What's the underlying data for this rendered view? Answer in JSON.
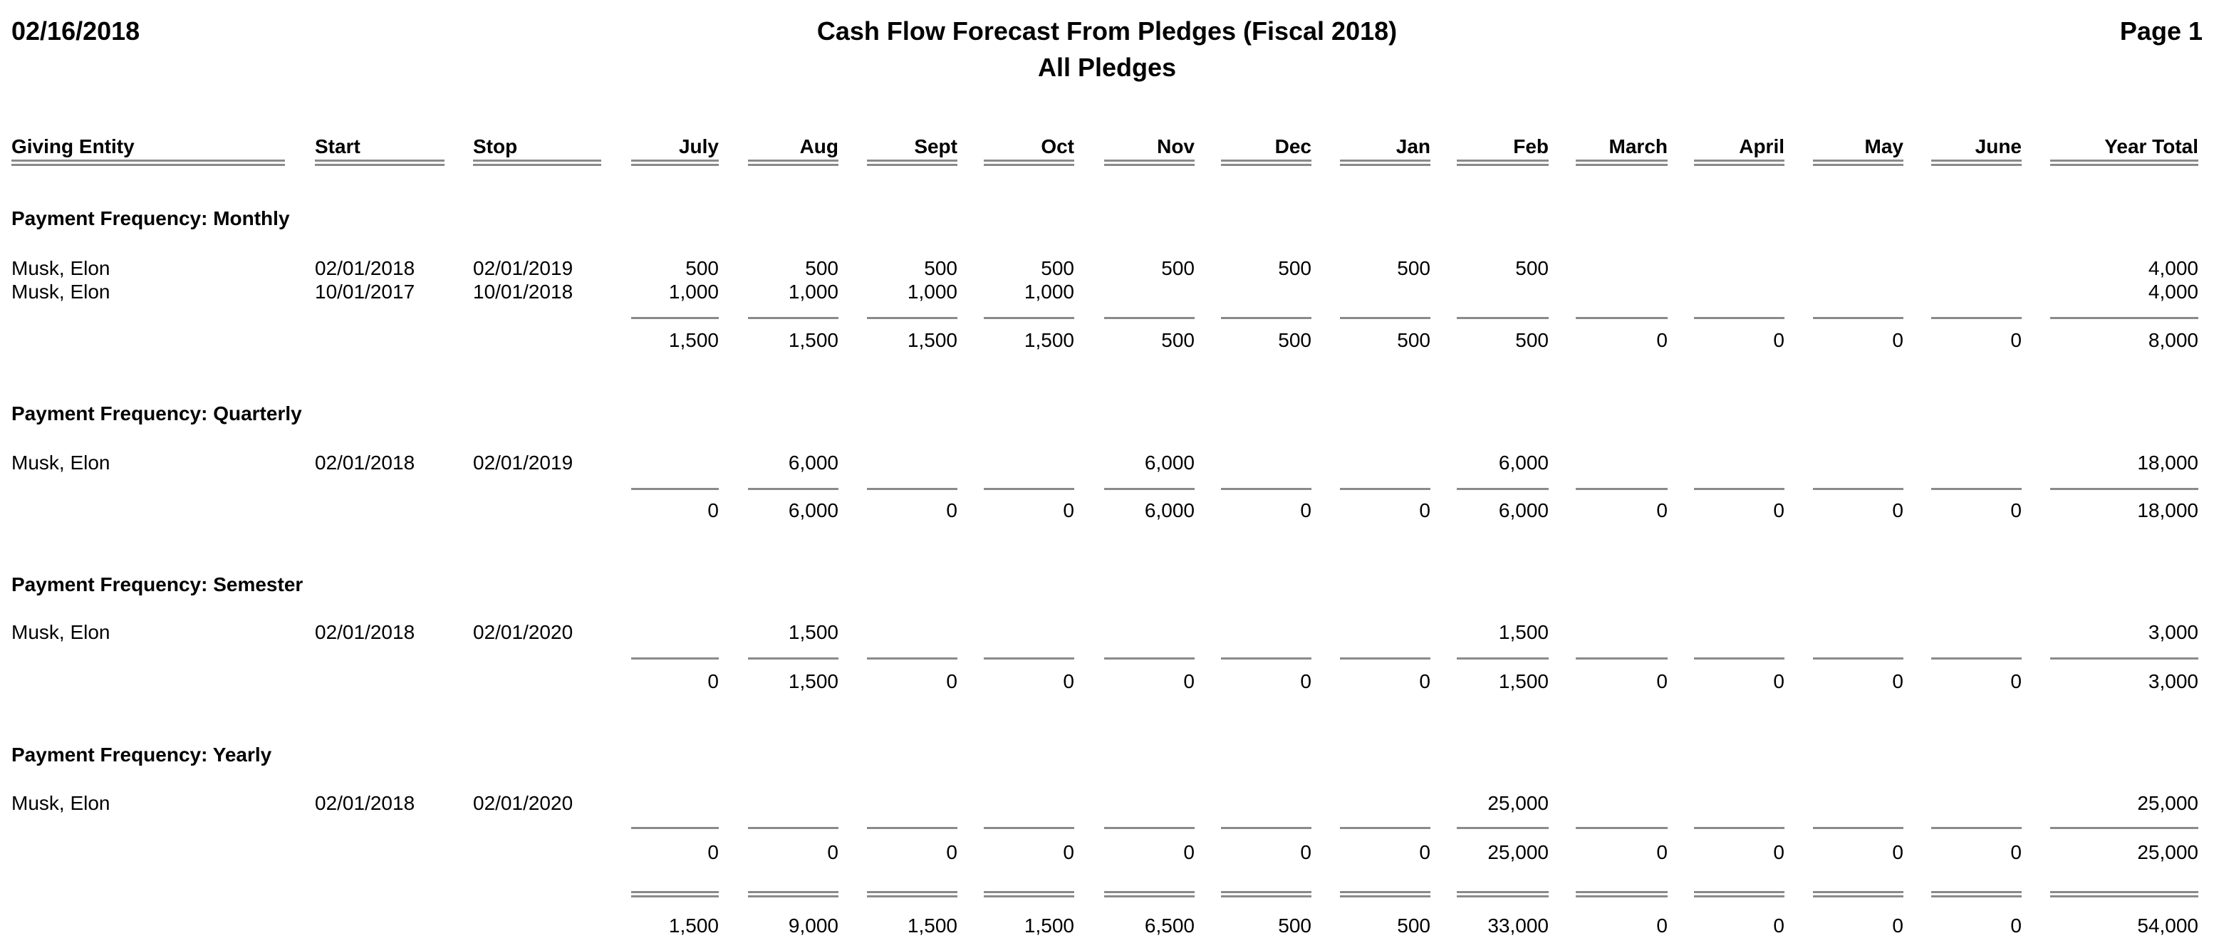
{
  "header": {
    "date": "02/16/2018",
    "title": "Cash Flow Forecast From Pledges (Fiscal 2018)",
    "subtitle": "All Pledges",
    "page": "Page 1"
  },
  "columns": [
    "Giving Entity",
    "Start",
    "Stop",
    "July",
    "Aug",
    "Sept",
    "Oct",
    "Nov",
    "Dec",
    "Jan",
    "Feb",
    "March",
    "April",
    "May",
    "June",
    "Year Total"
  ],
  "groups": [
    {
      "label": "Payment Frequency: Monthly",
      "rows": [
        {
          "entity": "Musk, Elon",
          "start": "02/01/2018",
          "stop": "02/01/2019",
          "months": [
            "500",
            "500",
            "500",
            "500",
            "500",
            "500",
            "500",
            "500",
            "",
            "",
            "",
            ""
          ],
          "total": "4,000"
        },
        {
          "entity": "Musk, Elon",
          "start": "10/01/2017",
          "stop": "10/01/2018",
          "months": [
            "1,000",
            "1,000",
            "1,000",
            "1,000",
            "",
            "",
            "",
            "",
            "",
            "",
            "",
            ""
          ],
          "total": "4,000"
        }
      ],
      "subtotal": {
        "months": [
          "1,500",
          "1,500",
          "1,500",
          "1,500",
          "500",
          "500",
          "500",
          "500",
          "0",
          "0",
          "0",
          "0"
        ],
        "total": "8,000"
      }
    },
    {
      "label": "Payment Frequency: Quarterly",
      "rows": [
        {
          "entity": "Musk, Elon",
          "start": "02/01/2018",
          "stop": "02/01/2019",
          "months": [
            "",
            "6,000",
            "",
            "",
            "6,000",
            "",
            "",
            "6,000",
            "",
            "",
            "",
            ""
          ],
          "total": "18,000"
        }
      ],
      "subtotal": {
        "months": [
          "0",
          "6,000",
          "0",
          "0",
          "6,000",
          "0",
          "0",
          "6,000",
          "0",
          "0",
          "0",
          "0"
        ],
        "total": "18,000"
      }
    },
    {
      "label": "Payment Frequency: Semester",
      "rows": [
        {
          "entity": "Musk, Elon",
          "start": "02/01/2018",
          "stop": "02/01/2020",
          "months": [
            "",
            "1,500",
            "",
            "",
            "",
            "",
            "",
            "1,500",
            "",
            "",
            "",
            ""
          ],
          "total": "3,000"
        }
      ],
      "subtotal": {
        "months": [
          "0",
          "1,500",
          "0",
          "0",
          "0",
          "0",
          "0",
          "1,500",
          "0",
          "0",
          "0",
          "0"
        ],
        "total": "3,000"
      }
    },
    {
      "label": "Payment Frequency: Yearly",
      "rows": [
        {
          "entity": "Musk, Elon",
          "start": "02/01/2018",
          "stop": "02/01/2020",
          "months": [
            "",
            "",
            "",
            "",
            "",
            "",
            "",
            "25,000",
            "",
            "",
            "",
            ""
          ],
          "total": "25,000"
        }
      ],
      "subtotal": {
        "months": [
          "0",
          "0",
          "0",
          "0",
          "0",
          "0",
          "0",
          "25,000",
          "0",
          "0",
          "0",
          "0"
        ],
        "total": "25,000"
      }
    }
  ],
  "grand_total": {
    "months": [
      "1,500",
      "9,000",
      "1,500",
      "1,500",
      "6,500",
      "500",
      "500",
      "33,000",
      "0",
      "0",
      "0",
      "0"
    ],
    "total": "54,000"
  }
}
